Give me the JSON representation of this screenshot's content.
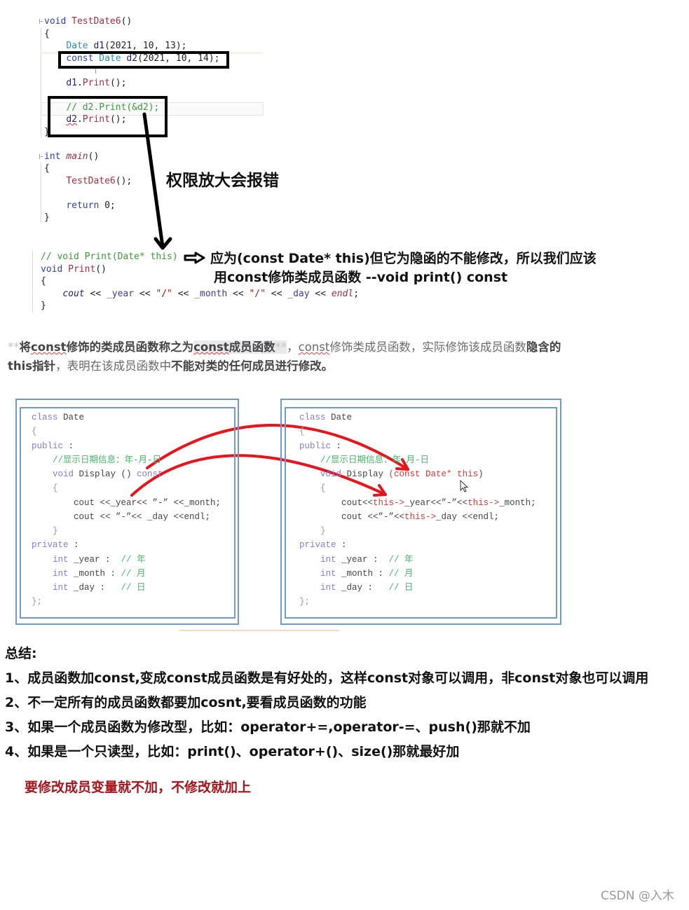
{
  "theme": {
    "editor_keyword": "#2e3fb3",
    "editor_function": "#a3303f",
    "editor_type": "#2b91af",
    "editor_variable": "#1f1f6e",
    "editor_member": "#3d3d9e",
    "editor_comment": "#3a9a3a",
    "editor_string": "#a31515",
    "annotation_box": "#000000",
    "box_border": "#6f9bc8",
    "box_keyword": "#7f7fd6",
    "box_comment": "#4cb36a",
    "box_highlight": "#d43a3a",
    "arrow_red": "#e8141b",
    "note_red": "#a3151c",
    "watermark": "#999999"
  },
  "editor_top": {
    "lines": [
      [
        {
          "t": "void",
          "k": "keyword"
        },
        {
          "t": " "
        },
        {
          "t": "TestDate6",
          "k": "function"
        },
        {
          "t": "()"
        }
      ],
      [
        {
          "t": "{"
        }
      ],
      [
        {
          "t": "    "
        },
        {
          "t": "Date",
          "k": "type"
        },
        {
          "t": " "
        },
        {
          "t": "d1",
          "k": "variable"
        },
        {
          "t": "(2021, 10, 13);"
        }
      ],
      [
        {
          "t": "    "
        },
        {
          "t": "const",
          "k": "keyword"
        },
        {
          "t": " "
        },
        {
          "t": "Date",
          "k": "type"
        },
        {
          "t": " "
        },
        {
          "t": "d2",
          "k": "variable"
        },
        {
          "t": "(2021, 10, 14);"
        }
      ],
      [],
      [
        {
          "t": "    "
        },
        {
          "t": "d1",
          "k": "variable"
        },
        {
          "t": "."
        },
        {
          "t": "Print",
          "k": "function"
        },
        {
          "t": "();"
        }
      ],
      [],
      [
        {
          "t": "    "
        },
        {
          "t": "// d2.Print(&d2);",
          "k": "comment"
        }
      ],
      [
        {
          "t": "    "
        },
        {
          "t": "d2",
          "k": "variable error"
        },
        {
          "t": "."
        },
        {
          "t": "Print",
          "k": "function"
        },
        {
          "t": "();"
        }
      ],
      [
        {
          "t": "}"
        }
      ],
      [],
      [
        {
          "t": "int",
          "k": "keyword"
        },
        {
          "t": " "
        },
        {
          "t": "main",
          "k": "function italic"
        },
        {
          "t": "()"
        }
      ],
      [
        {
          "t": "{"
        }
      ],
      [
        {
          "t": "    "
        },
        {
          "t": "TestDate6",
          "k": "function"
        },
        {
          "t": "();"
        }
      ],
      [],
      [
        {
          "t": "    "
        },
        {
          "t": "return",
          "k": "keyword"
        },
        {
          "t": " 0;"
        }
      ],
      [
        {
          "t": "}"
        }
      ]
    ]
  },
  "annotation_error": "权限放大会报错",
  "editor_print": {
    "lines": [
      [
        {
          "t": "// void Print(Date* this)",
          "k": "comment"
        }
      ],
      [
        {
          "t": "void",
          "k": "keyword"
        },
        {
          "t": " "
        },
        {
          "t": "Print",
          "k": "function"
        },
        {
          "t": "()"
        }
      ],
      [
        {
          "t": "{"
        }
      ],
      [
        {
          "t": "    "
        },
        {
          "t": "cout",
          "k": "variable italic"
        },
        {
          "t": " << "
        },
        {
          "t": "_year",
          "k": "member"
        },
        {
          "t": " << "
        },
        {
          "t": "\"/\"",
          "k": "string"
        },
        {
          "t": " << "
        },
        {
          "t": "_month",
          "k": "member"
        },
        {
          "t": " << "
        },
        {
          "t": "\"/\"",
          "k": "string"
        },
        {
          "t": " << "
        },
        {
          "t": "_day",
          "k": "member"
        },
        {
          "t": " << "
        },
        {
          "t": "endl",
          "k": "function italic"
        },
        {
          "t": ";"
        }
      ],
      [
        {
          "t": "}"
        }
      ]
    ]
  },
  "annotation_explain": {
    "line1": "应为(const Date* this)但它为隐函的不能修改，所以我们应该",
    "line2": "用const修饰类成员函数 --void  print() const"
  },
  "paragraph": {
    "lines": [
      [
        {
          "t": "**",
          "k": "marker"
        },
        {
          "t": "将",
          "k": "bold"
        },
        {
          "t": "const",
          "k": "bold squiggle"
        },
        {
          "t": "修饰的类成员函数称之为",
          "k": "bold"
        },
        {
          "t": "const",
          "k": "bold squiggle highlight"
        },
        {
          "t": "成员函数",
          "k": "bold highlight"
        },
        {
          "t": "**",
          "k": "marker highlight"
        },
        {
          "t": "，"
        },
        {
          "t": "const",
          "k": "squiggle"
        },
        {
          "t": "修饰类成员函数，实际修饰该成员函数"
        },
        {
          "t": "隐含的",
          "k": "bold"
        }
      ],
      [
        {
          "t": "this指针",
          "k": "bold"
        },
        {
          "t": "，表明在该成员函数中"
        },
        {
          "t": "不能对类的任何成员进行修改。",
          "k": "bold"
        }
      ]
    ]
  },
  "class_compare": {
    "left": {
      "lines": [
        [
          {
            "t": "class",
            "k": "keyword"
          },
          {
            "t": " Date"
          }
        ],
        [
          {
            "t": "{",
            "k": "brace"
          }
        ],
        [
          {
            "t": "public",
            "k": "keyword"
          },
          {
            "t": " :"
          }
        ],
        [
          {
            "t": "    "
          },
          {
            "t": "//显示日期信息：年-月-日",
            "k": "comment"
          }
        ],
        [
          {
            "t": "    "
          },
          {
            "t": "void",
            "k": "keyword"
          },
          {
            "t": " Display () "
          },
          {
            "t": "const",
            "k": "keyword"
          }
        ],
        [
          {
            "t": "    "
          },
          {
            "t": "{",
            "k": "brace"
          }
        ],
        [
          {
            "t": "        cout <<_year<< ”-” <<_month;"
          }
        ],
        [
          {
            "t": "        cout << ”-”<< _day <<endl;"
          }
        ],
        [
          {
            "t": "    "
          },
          {
            "t": "}",
            "k": "brace"
          }
        ],
        [
          {
            "t": "private",
            "k": "keyword"
          },
          {
            "t": " :"
          }
        ],
        [
          {
            "t": "    "
          },
          {
            "t": "int",
            "k": "keyword"
          },
          {
            "t": " _year :  "
          },
          {
            "t": "// 年",
            "k": "comment"
          }
        ],
        [
          {
            "t": "    "
          },
          {
            "t": "int",
            "k": "keyword"
          },
          {
            "t": " _month : "
          },
          {
            "t": "// 月",
            "k": "comment"
          }
        ],
        [
          {
            "t": "    "
          },
          {
            "t": "int",
            "k": "keyword"
          },
          {
            "t": " _day :   "
          },
          {
            "t": "// 日",
            "k": "comment"
          }
        ],
        [
          {
            "t": "};",
            "k": "brace"
          }
        ]
      ]
    },
    "right": {
      "lines": [
        [
          {
            "t": "class",
            "k": "keyword"
          },
          {
            "t": " Date"
          }
        ],
        [
          {
            "t": "{",
            "k": "brace"
          }
        ],
        [
          {
            "t": "public",
            "k": "keyword"
          },
          {
            "t": " :"
          }
        ],
        [
          {
            "t": "    "
          },
          {
            "t": "//显示日期信息：年-月-日",
            "k": "comment"
          }
        ],
        [
          {
            "t": "    "
          },
          {
            "t": "void",
            "k": "keyword"
          },
          {
            "t": " Display "
          },
          {
            "t": "(const Date* this",
            "k": "hl"
          },
          {
            "t": ")"
          }
        ],
        [
          {
            "t": "    "
          },
          {
            "t": "{",
            "k": "brace"
          }
        ],
        [
          {
            "t": "        cout<<"
          },
          {
            "t": "this->",
            "k": "hl"
          },
          {
            "t": "_year<<”-”<<"
          },
          {
            "t": "this->",
            "k": "hl"
          },
          {
            "t": "_month;"
          }
        ],
        [
          {
            "t": "        cout <<”-”<<"
          },
          {
            "t": "this->",
            "k": "hl"
          },
          {
            "t": "_day <<endl;"
          }
        ],
        [
          {
            "t": "    "
          },
          {
            "t": "}",
            "k": "brace"
          }
        ],
        [
          {
            "t": "private",
            "k": "keyword"
          },
          {
            "t": " :"
          }
        ],
        [
          {
            "t": "    "
          },
          {
            "t": "int",
            "k": "keyword"
          },
          {
            "t": " _year :  "
          },
          {
            "t": "// 年",
            "k": "comment"
          }
        ],
        [
          {
            "t": "    "
          },
          {
            "t": "int",
            "k": "keyword"
          },
          {
            "t": " _month : "
          },
          {
            "t": "// 月",
            "k": "comment"
          }
        ],
        [
          {
            "t": "    "
          },
          {
            "t": "int",
            "k": "keyword"
          },
          {
            "t": " _day :   "
          },
          {
            "t": "// 日",
            "k": "comment"
          }
        ],
        [
          {
            "t": "};",
            "k": "brace"
          }
        ]
      ]
    }
  },
  "summary": {
    "title": "总结:",
    "items": [
      "1、成员函数加const,变成const成员函数是有好处的，这样const对象可以调用，非const对象也可以调用",
      "2、不一定所有的成员函数都要加cosnt,要看成员函数的功能",
      "3、如果一个成员函数为修改型，比如：operator+=,operator-=、push()那就不加",
      "4、如果是一个只读型，比如：print()、operator+()、size()那就最好加"
    ],
    "note": "要修改成员变量就不加，不修改就加上"
  },
  "watermark": "CSDN @入木"
}
